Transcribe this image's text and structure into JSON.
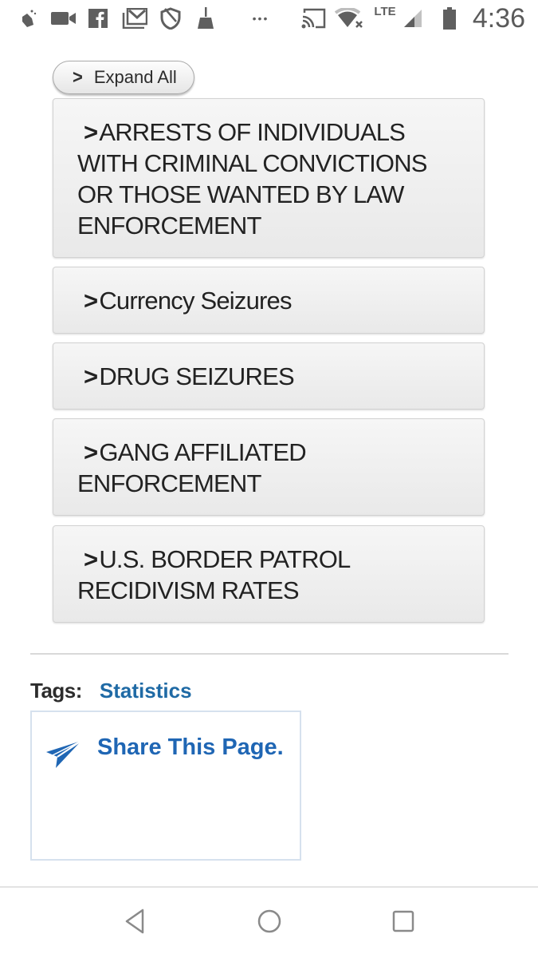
{
  "status_bar": {
    "left_icons": [
      "clap-icon",
      "video-camera-icon",
      "facebook-icon",
      "gmail-icon",
      "shield-icon",
      "broom-icon",
      "more-dots-icon"
    ],
    "right_icons": [
      "cast-icon",
      "wifi-off-icon",
      "lte-icon",
      "signal-icon",
      "battery-icon"
    ],
    "lte_label": "LTE",
    "more_label": "•••",
    "time": "4:36"
  },
  "expand_all": {
    "icon": "chevron-right-icon",
    "label": "Expand All"
  },
  "accordion": [
    {
      "label": "ARRESTS OF INDIVIDUALS WITH CRIMINAL CONVICTIONS OR THOSE WANTED BY LAW ENFORCEMENT"
    },
    {
      "label": "Currency Seizures"
    },
    {
      "label": "DRUG SEIZURES"
    },
    {
      "label": "GANG AFFILIATED ENFORCEMENT"
    },
    {
      "label": "U.S. BORDER PATROL RECIDIVISM RATES"
    }
  ],
  "tags": {
    "label": "Tags:",
    "items": [
      "Statistics"
    ]
  },
  "share": {
    "icon": "paper-plane-icon",
    "label": "Share This Page."
  },
  "nav_bar": {
    "back": "back-icon",
    "home": "home-icon",
    "recents": "recents-icon"
  },
  "colors": {
    "link": "#1f6aa5",
    "share": "#1f66b4",
    "text": "#222222"
  }
}
